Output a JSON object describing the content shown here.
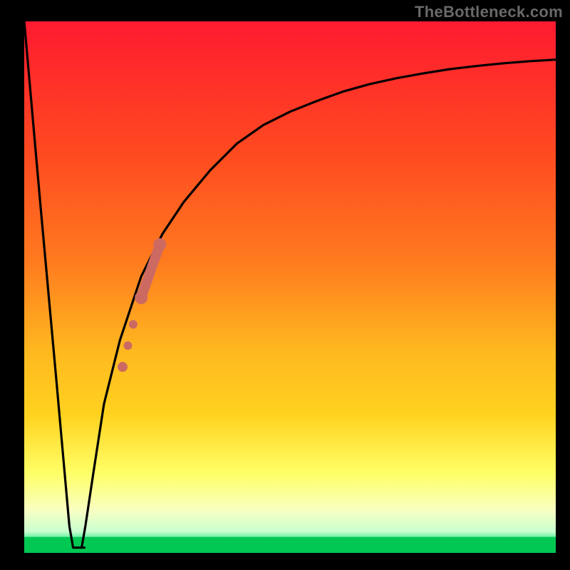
{
  "attribution": "TheBottleneck.com",
  "colors": {
    "frame": "#000000",
    "curve": "#000000",
    "marker": "#cc6a62",
    "gradient_top": "#ff1a30",
    "gradient_mid_upper": "#ff7a1f",
    "gradient_mid": "#ffd21f",
    "gradient_mid_lower": "#ffff66",
    "gradient_pale_band": "#f8ffc2",
    "gradient_green": "#17e07a",
    "gradient_bottom": "#00c853"
  },
  "chart_data": {
    "type": "line",
    "title": "",
    "xlabel": "",
    "ylabel": "",
    "xlim": [
      0,
      100
    ],
    "ylim": [
      0,
      100
    ],
    "grid": false,
    "series": [
      {
        "name": "bottleneck-curve",
        "x": [
          0,
          3,
          6,
          8.5,
          9.2,
          10,
          10.8,
          11.5,
          13,
          15,
          18,
          22,
          26,
          30,
          35,
          40,
          45,
          50,
          55,
          60,
          65,
          70,
          75,
          80,
          85,
          90,
          95,
          100
        ],
        "y": [
          100,
          66,
          33,
          5,
          1,
          1,
          1,
          5,
          15,
          28,
          40,
          52,
          60,
          66,
          72,
          77,
          80.5,
          83,
          85,
          86.8,
          88.2,
          89.3,
          90.2,
          91,
          91.6,
          92.1,
          92.5,
          92.8
        ]
      }
    ],
    "markers": {
      "name": "highlighted-points",
      "style": "dots-and-bar",
      "points": [
        {
          "x": 18.5,
          "y": 35,
          "size": 7
        },
        {
          "x": 19.5,
          "y": 39,
          "size": 6
        },
        {
          "x": 20.5,
          "y": 43,
          "size": 6
        },
        {
          "x": 22.0,
          "y": 48,
          "size": 9
        },
        {
          "x": 25.5,
          "y": 58,
          "size": 9
        }
      ],
      "bar": {
        "x1": 22.0,
        "y1": 48,
        "x2": 25.5,
        "y2": 58,
        "width": 14
      }
    },
    "green_band": {
      "y_from": 0,
      "y_to": 3
    },
    "notch": {
      "x_from": 9.2,
      "x_to": 11.5,
      "y": 1
    }
  }
}
